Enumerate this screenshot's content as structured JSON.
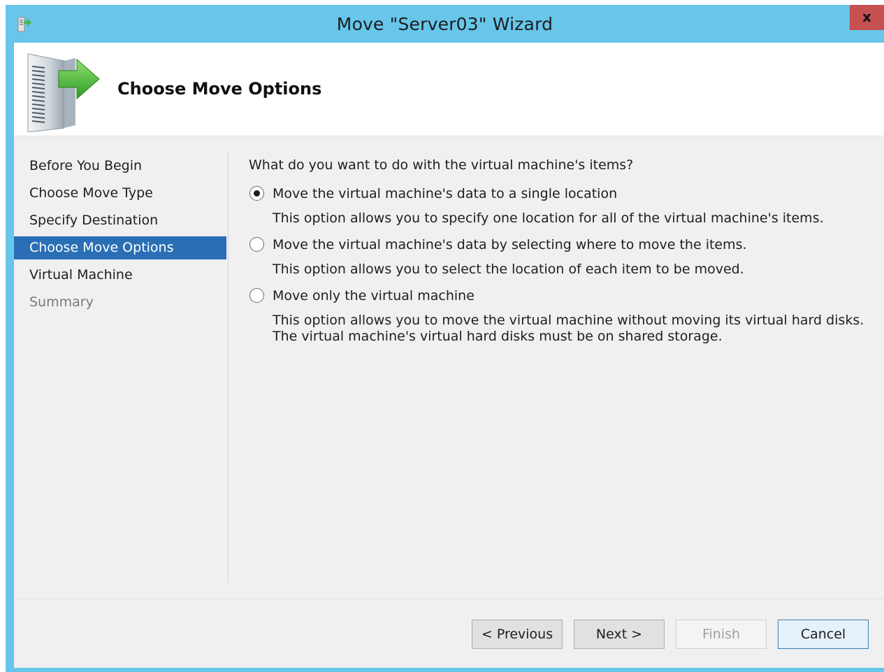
{
  "window": {
    "title": "Move \"Server03\" Wizard",
    "close_label": "x",
    "accent_color": "#67c6ea"
  },
  "header": {
    "title": "Choose Move Options",
    "icon": "server-move-icon"
  },
  "nav": {
    "items": [
      {
        "label": "Before You Begin",
        "state": "normal"
      },
      {
        "label": "Choose Move Type",
        "state": "normal"
      },
      {
        "label": "Specify Destination",
        "state": "normal"
      },
      {
        "label": "Choose Move Options",
        "state": "active"
      },
      {
        "label": "Virtual Machine",
        "state": "normal"
      },
      {
        "label": "Summary",
        "state": "disabled"
      }
    ],
    "active_color": "#2a6fb5"
  },
  "content": {
    "question": "What do you want to do with the virtual machine's items?",
    "options": [
      {
        "label": "Move the virtual machine's data to a single location",
        "description": "This option allows you to specify one location for all of the virtual machine's items.",
        "selected": true
      },
      {
        "label": "Move the virtual machine's data by selecting where to move the items.",
        "description": "This option allows you to select the location of each item to be moved.",
        "selected": false
      },
      {
        "label": "Move only the virtual machine",
        "description": "This option allows you to move the virtual machine without moving its virtual hard disks. The virtual machine's virtual hard disks must be on shared storage.",
        "selected": false
      }
    ]
  },
  "buttons": {
    "previous": "< Previous",
    "next": "Next >",
    "finish": "Finish",
    "cancel": "Cancel"
  }
}
